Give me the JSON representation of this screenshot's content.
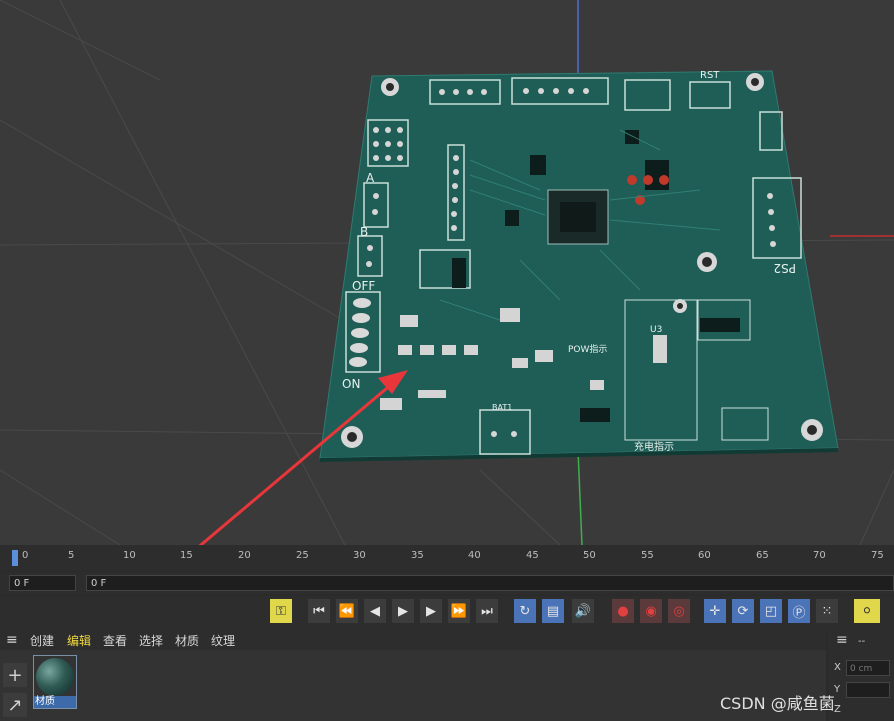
{
  "timeline": {
    "ticks": [
      "0",
      "5",
      "10",
      "15",
      "20",
      "25",
      "30",
      "35",
      "40",
      "45",
      "50",
      "55",
      "60",
      "65",
      "70",
      "75"
    ]
  },
  "frame": {
    "current_value": "0 F",
    "track_value": "0 F"
  },
  "menu": {
    "items": [
      {
        "label": "创建"
      },
      {
        "label": "编辑"
      },
      {
        "label": "查看"
      },
      {
        "label": "选择"
      },
      {
        "label": "材质"
      },
      {
        "label": "纹理"
      }
    ]
  },
  "material": {
    "name": "材质"
  },
  "attributes": {
    "dash": "--",
    "x_label": "X",
    "x_value": "0 cm",
    "y_label": "Y",
    "z_label": "Z"
  },
  "pcb_text": {
    "ps2": "PS2",
    "off": "OFF",
    "on": "ON",
    "rst": "RST",
    "u3": "U3",
    "a": "A",
    "b": "B",
    "bat1": "BAT1",
    "pow": "POW指示",
    "charge": "充电指示"
  },
  "watermark": "CSDN @咸鱼菌",
  "colors": {
    "pcb": "#1f5e57",
    "active_menu": "#f2d940",
    "arrow": "#e8363a",
    "highlight_blue": "#4a73b8"
  }
}
